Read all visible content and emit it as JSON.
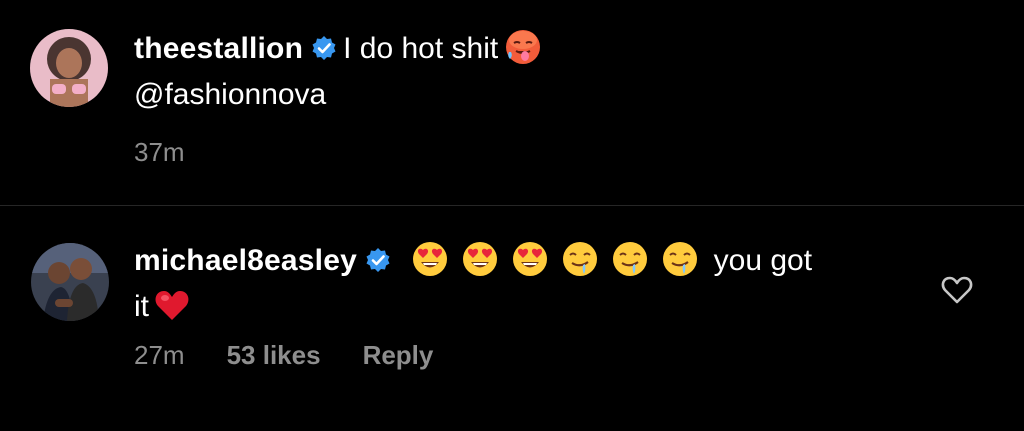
{
  "caption": {
    "username": "theestallion",
    "text": "I do hot shit",
    "mention": "@fashionnova",
    "time": "37m",
    "emoji": "hot-face"
  },
  "comment": {
    "username": "michael8easley",
    "text_before": "",
    "text_after": "you got",
    "text_line2": "it",
    "emojis": [
      "heart-eyes",
      "heart-eyes",
      "heart-eyes",
      "drooling",
      "drooling",
      "drooling",
      "red-heart"
    ],
    "time": "27m",
    "likes": "53 likes",
    "reply": "Reply"
  },
  "colors": {
    "background": "#000000",
    "text": "#ffffff",
    "meta": "#8e8e8e",
    "verified": "#3897f0",
    "divider": "#262626"
  },
  "icons": [
    "verified-badge-icon",
    "hot-face-emoji",
    "heart-eyes-emoji",
    "drooling-face-emoji",
    "red-heart-emoji",
    "like-heart-icon"
  ]
}
